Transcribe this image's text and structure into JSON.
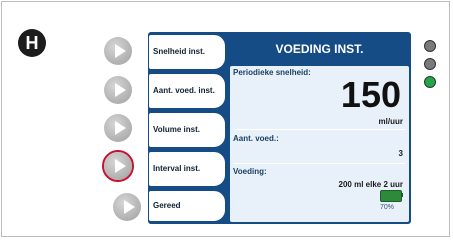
{
  "badge_letter": "H",
  "menu": {
    "items": [
      {
        "label": "Snelheid inst."
      },
      {
        "label": "Aant. voed. inst."
      },
      {
        "label": "Volume inst."
      },
      {
        "label": "Interval inst."
      },
      {
        "label": "Gereed"
      }
    ]
  },
  "screen": {
    "title": "VOEDING INST.",
    "rate_label": "Periodieke snelheid:",
    "rate_value": "150",
    "rate_unit": "ml/uur",
    "feeds_label": "Aant. voed.:",
    "feeds_value": "3",
    "feeding_label": "Voeding:",
    "feeding_value": "200 ml elke 2 uur",
    "battery_text": "70%",
    "battery_level_percent": 70
  },
  "leds": [
    {
      "color": "#7a7a7a"
    },
    {
      "color": "#7a7a7a"
    },
    {
      "color": "#1fa84a"
    }
  ]
}
